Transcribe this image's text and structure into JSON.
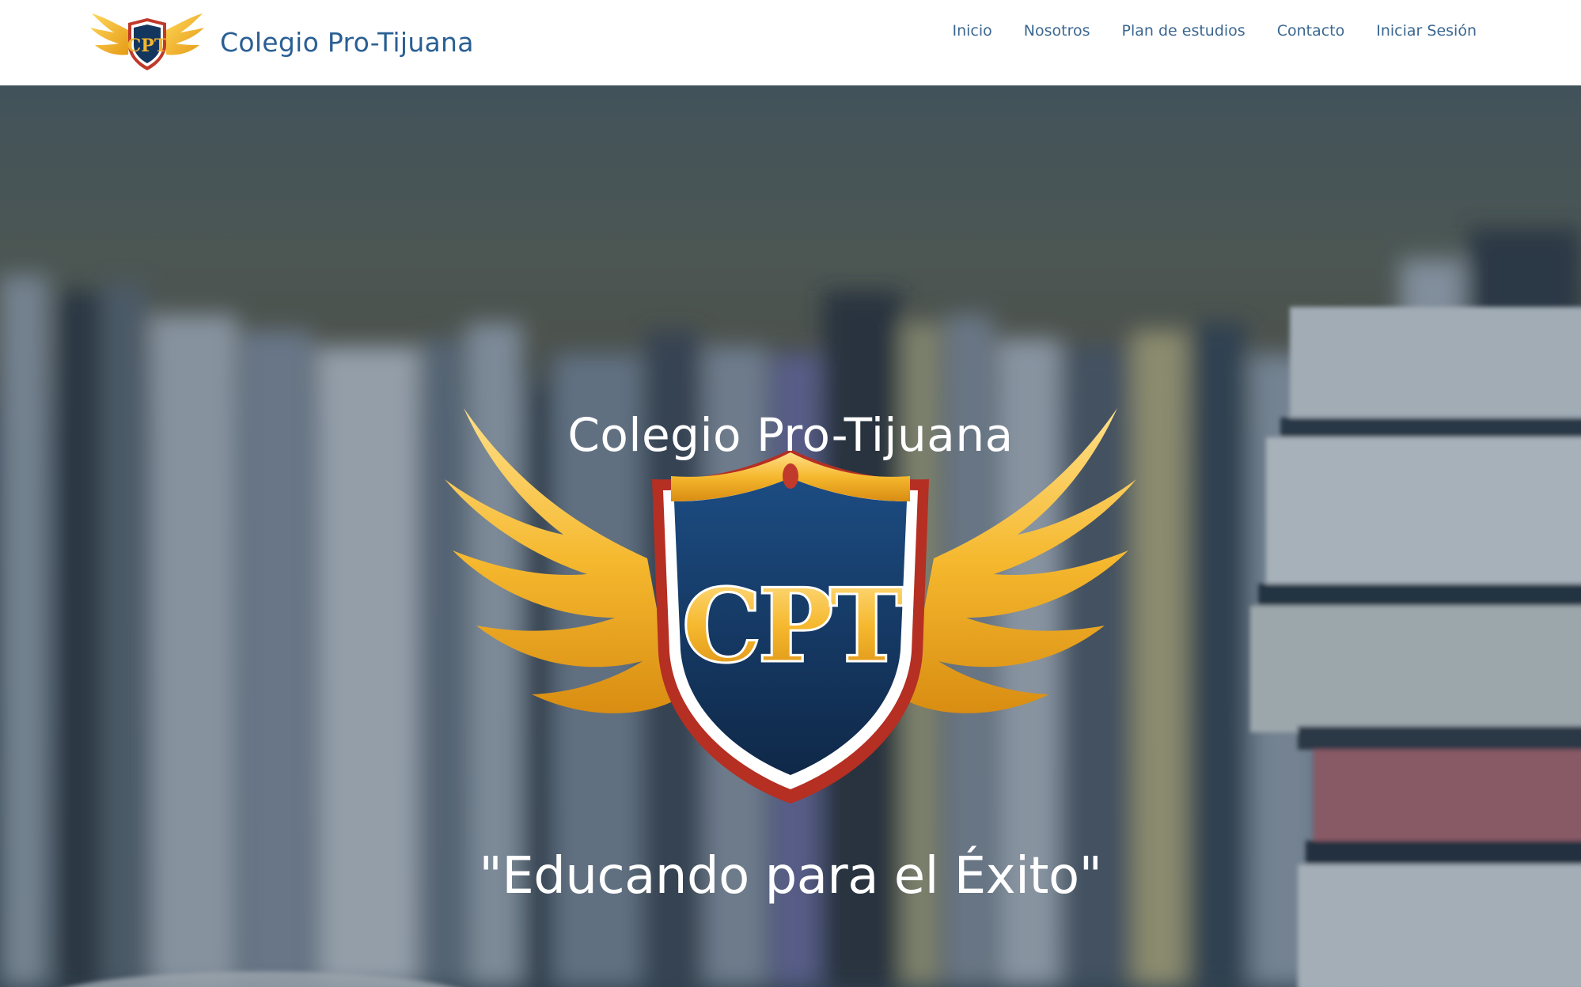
{
  "header": {
    "brand_name": "Colegio Pro-Tijuana",
    "logo_letters": "CPT",
    "nav": [
      {
        "label": "Inicio"
      },
      {
        "label": "Nosotros"
      },
      {
        "label": "Plan de estudios"
      },
      {
        "label": "Contacto"
      },
      {
        "label": "Iniciar Sesión"
      }
    ]
  },
  "hero": {
    "title": "Colegio Pro-Tijuana",
    "emblem_letters": "CPT",
    "tagline": "\"Educando para el Éxito\""
  },
  "colors": {
    "brand_blue": "#2a5f93",
    "nav_blue": "#3b6790",
    "shield_navy": "#13365f",
    "wing_gold": "#f2b52f",
    "crest_red": "#c0392b"
  },
  "icons": [
    "cpt-logo-icon",
    "cpt-emblem-icon"
  ]
}
